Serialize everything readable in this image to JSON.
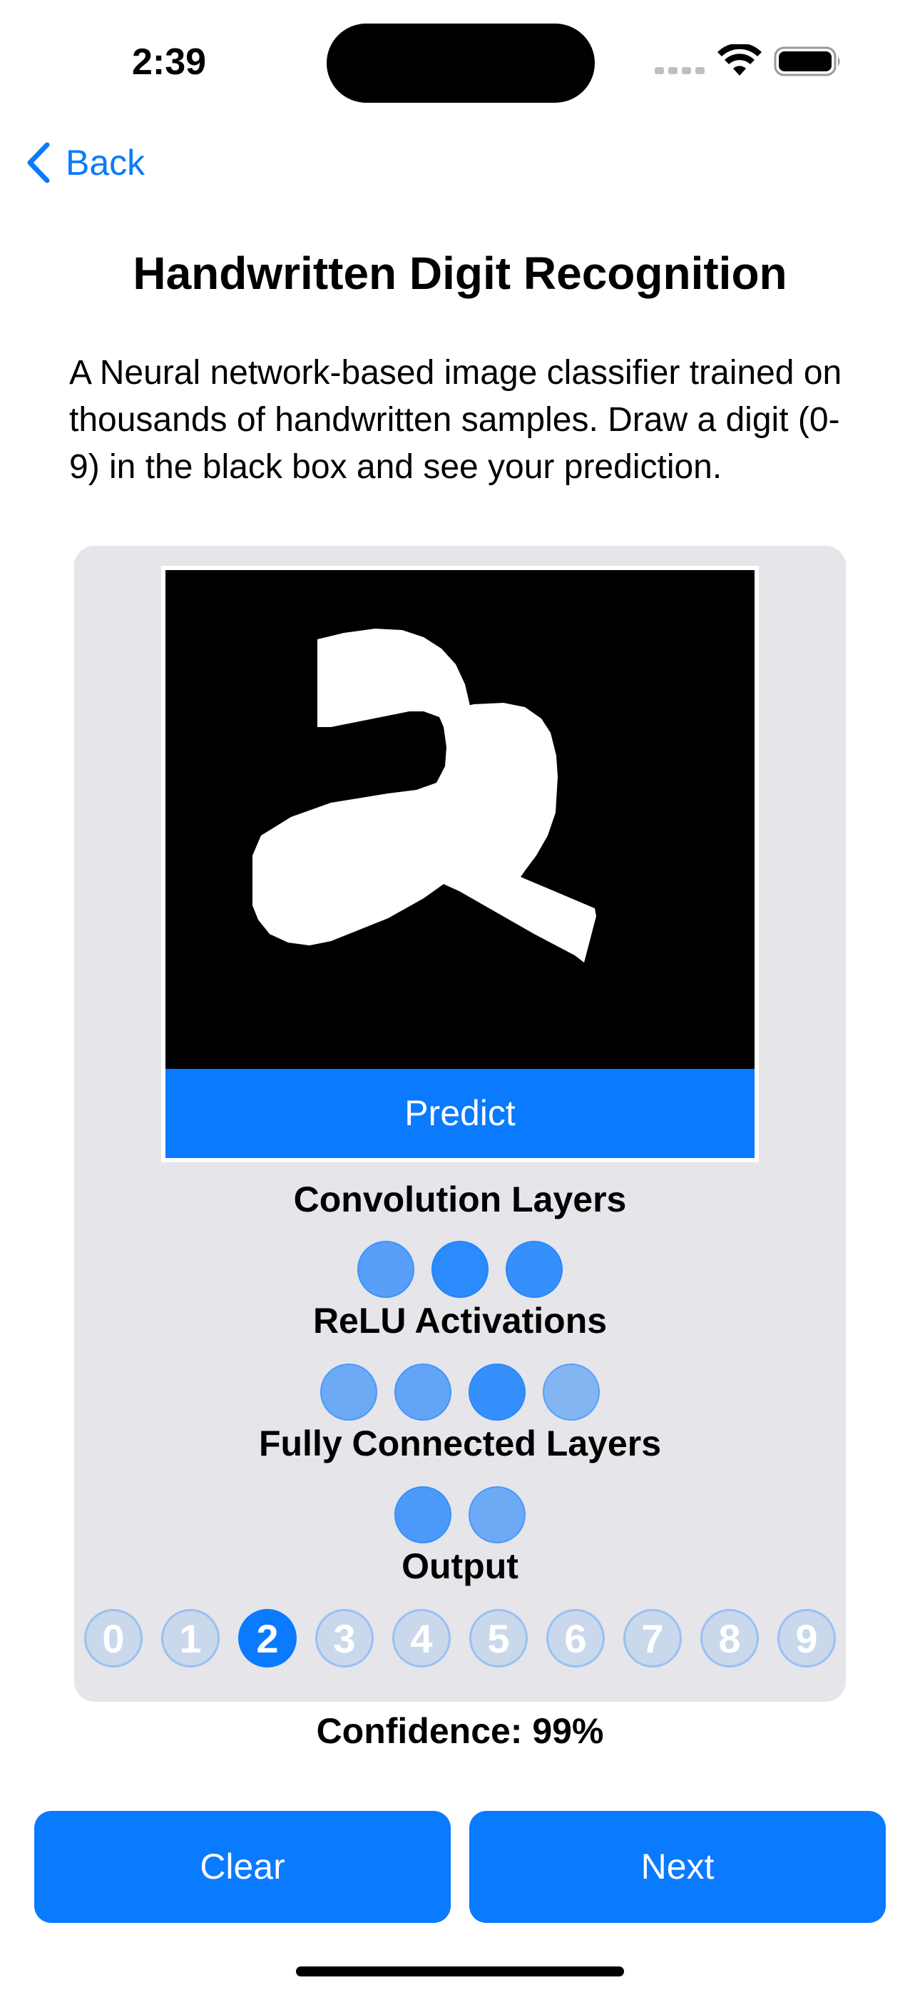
{
  "status_bar": {
    "time": "2:39",
    "icons": [
      "signal-icon",
      "wifi-icon",
      "battery-icon"
    ]
  },
  "nav": {
    "back_label": "Back",
    "back_icon": "chevron-left-icon"
  },
  "page": {
    "title": "Handwritten Digit Recognition",
    "description": "A Neural network-based image classifier trained on thousands of handwritten samples. Draw a digit (0-9) in the black box and see your prediction."
  },
  "canvas": {
    "drawn_digit_shape": "2",
    "predict_label": "Predict"
  },
  "network": {
    "layers": [
      {
        "label": "Convolution Layers",
        "node_opacities": [
          0.65,
          0.85,
          0.8
        ]
      },
      {
        "label": "ReLU Activations",
        "node_opacities": [
          0.55,
          0.6,
          0.8,
          0.45
        ]
      },
      {
        "label": "Fully Connected Layers",
        "node_opacities": [
          0.7,
          0.55
        ]
      }
    ],
    "output_label": "Output",
    "digits": [
      "0",
      "1",
      "2",
      "3",
      "4",
      "5",
      "6",
      "7",
      "8",
      "9"
    ],
    "predicted_digit": "2"
  },
  "result": {
    "confidence_text": "Confidence: 99%"
  },
  "actions": {
    "clear_label": "Clear",
    "next_label": "Next"
  },
  "colors": {
    "accent": "#0a7aff",
    "panel_bg": "#e5e5ea",
    "canvas_bg": "#000000"
  }
}
